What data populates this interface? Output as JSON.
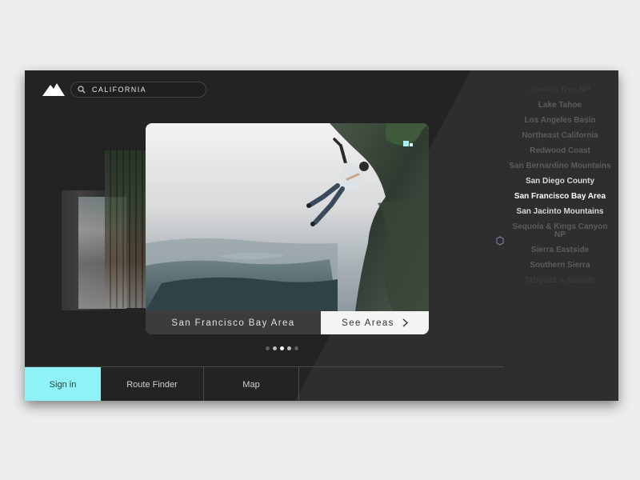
{
  "search": {
    "value": "CALIFORNIA"
  },
  "carousel": {
    "current_area": "San Francisco Bay Area",
    "cta_label": "See Areas",
    "dot_count": 5,
    "active_index": 2
  },
  "nav": {
    "sign_in": "Sign in",
    "route_finder": "Route Finder",
    "map": "Map"
  },
  "regions": [
    {
      "label": "Joshua Tree NP",
      "state": "faded"
    },
    {
      "label": "Lake Tahoe",
      "state": "dim"
    },
    {
      "label": "Los Angeles Basin",
      "state": "dim"
    },
    {
      "label": "Northeast California",
      "state": "dim"
    },
    {
      "label": "Redwood Coast",
      "state": "dim"
    },
    {
      "label": "San Bernardino Mountains",
      "state": "dim"
    },
    {
      "label": "San Diego County",
      "state": "near"
    },
    {
      "label": "San Francisco Bay Area",
      "state": "selected"
    },
    {
      "label": "San Jacinto Mountains",
      "state": "near"
    },
    {
      "label": "Sequoia & Kings Canyon NP",
      "state": "dim"
    },
    {
      "label": "Sierra Eastside",
      "state": "dim"
    },
    {
      "label": "Southern Sierra",
      "state": "dim"
    },
    {
      "label": "Tahquitz & Suicide",
      "state": "faded"
    }
  ],
  "colors": {
    "app_bg": "#232323",
    "accent": "#8ef2f6",
    "cta_bg": "#f4f4f4",
    "region_selected": "#ffffff",
    "region_near": "#d8d8d8",
    "region_dim": "#5c5c5c",
    "region_faded": "#3a3a3a"
  },
  "icons": {
    "logo": "mountain-logo-icon",
    "search": "search-icon",
    "cta": "chevron-right-icon",
    "pager": "hexagon-icon"
  }
}
